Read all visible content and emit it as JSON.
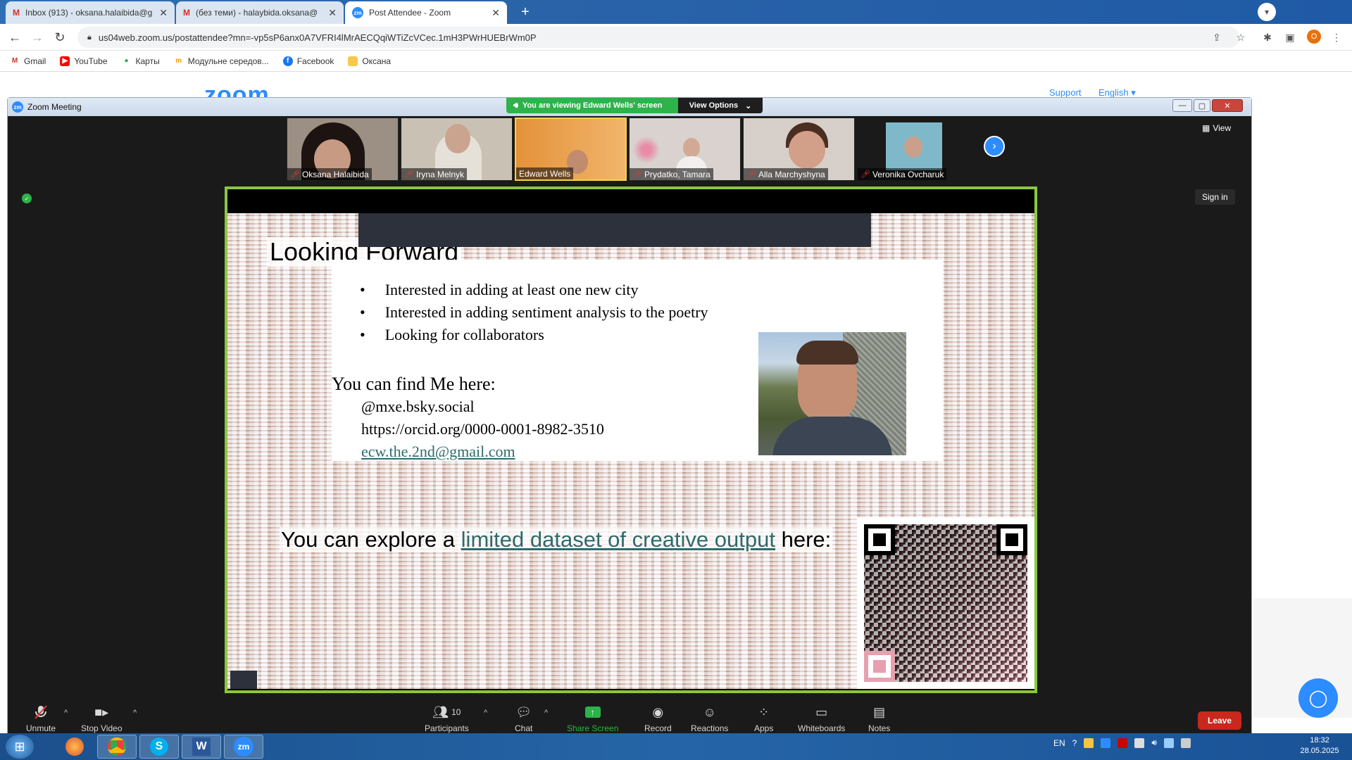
{
  "browser": {
    "tabs": [
      {
        "title": "Inbox (913) - oksana.halaibida@g",
        "icon": "gmail-icon"
      },
      {
        "title": "(без теми) - halaybida.oksana@",
        "icon": "gmail-icon"
      },
      {
        "title": "Post Attendee - Zoom",
        "icon": "zoom-icon"
      }
    ],
    "url": "us04web.zoom.us/postattendee?mn=-vp5sP6anx0A7VFRI4lMrAECQqiWTiZcVCec.1mH3PWrHUEBrWm0P",
    "profile_letter": "O",
    "bookmarks": [
      "Gmail",
      "YouTube",
      "Карты",
      "Модульне середов...",
      "Facebook",
      "Оксана"
    ]
  },
  "webpage": {
    "logo": "zoom",
    "links": [
      "Support",
      "English"
    ]
  },
  "zoom": {
    "window_title": "Zoom Meeting",
    "viewing_banner": "You are viewing Edward Wells' screen",
    "view_options": "View Options",
    "view_button": "View",
    "sign_in": "Sign in",
    "participants": [
      {
        "name": "Oksana Halaibida",
        "muted": true,
        "bg": "#9c8f84"
      },
      {
        "name": "Iryna Melnyk",
        "muted": true,
        "bg": "#c9c2b4"
      },
      {
        "name": "Edward Wells",
        "muted": false,
        "bg": "#e7a14e"
      },
      {
        "name": "Prydatko, Tamara",
        "muted": true,
        "bg": "#d9d2cf"
      },
      {
        "name": "Alla Marchyshyna",
        "muted": true,
        "bg": "#d7cfc9"
      },
      {
        "name": "Veronika Ovcharuk",
        "muted": true,
        "bg": "#1a1a1a"
      }
    ],
    "slide": {
      "title": "Looking Forward",
      "bullets": [
        "Interested in adding at least one new city",
        "Interested in adding sentiment analysis to the poetry",
        "Looking for collaborators"
      ],
      "find_me": "You can find Me here:",
      "contacts": [
        "@mxe.bsky.social",
        "https://orcid.org/0000-0001-8982-3510",
        "ecw.the.2nd@gmail.com"
      ],
      "explore_prefix": "You can explore a ",
      "explore_link": "limited dataset of creative output",
      "explore_suffix": " here:"
    },
    "toolbar": {
      "unmute": "Unmute",
      "stop_video": "Stop Video",
      "participants": "Participants",
      "participants_count": "10",
      "chat": "Chat",
      "share_screen": "Share Screen",
      "record": "Record",
      "reactions": "Reactions",
      "apps": "Apps",
      "whiteboards": "Whiteboards",
      "notes": "Notes",
      "leave": "Leave"
    },
    "colors": {
      "accent": "#2d8cff",
      "share_border": "#8dc63f",
      "leave": "#c8281e",
      "banner": "#2db34a"
    }
  },
  "taskbar": {
    "language": "EN",
    "time": "18:32",
    "date": "28.05.2025"
  }
}
